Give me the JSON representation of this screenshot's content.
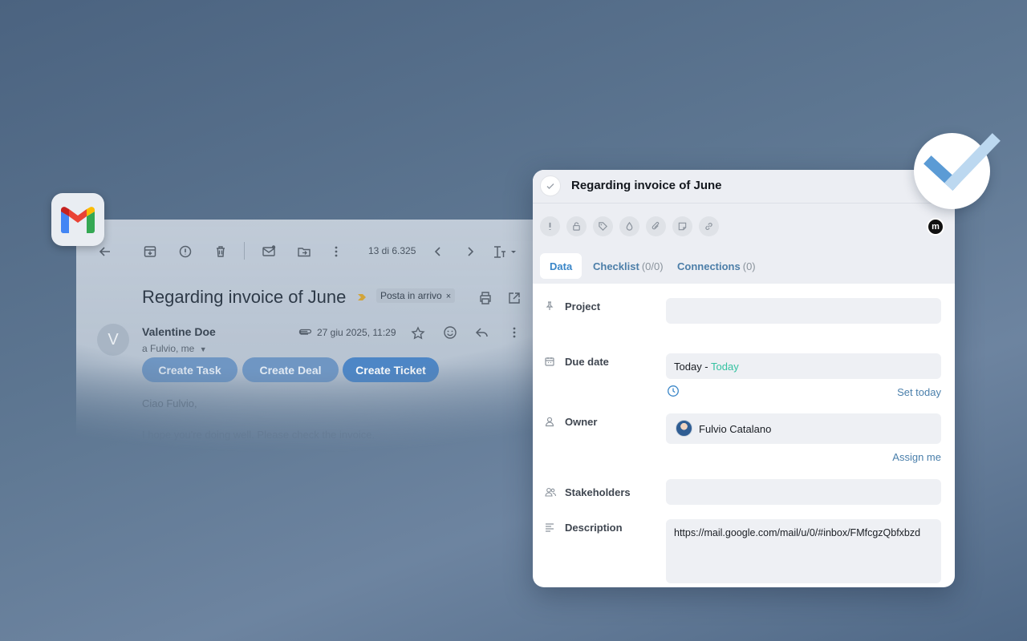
{
  "gmail": {
    "message_count": "13 di 6.325",
    "subject": "Regarding invoice of June",
    "label": "Posta in arrivo",
    "label_close": "×",
    "avatar_letter": "V",
    "sender": "Valentine Doe",
    "recipients": "a Fulvio, me",
    "date": "27 giu 2025, 11:29",
    "buttons": [
      "Create Task",
      "Create Deal",
      "Create Ticket"
    ],
    "body_greeting": "Ciao Fulvio,",
    "body_text": "I hope you're doing well. Please check the invoice."
  },
  "task": {
    "title": "Regarding invoice of June",
    "brand_letter": "m",
    "tabs": [
      {
        "label": "Data",
        "count": ""
      },
      {
        "label": "Checklist",
        "count": "(0/0)"
      },
      {
        "label": "Connections",
        "count": "(0)"
      }
    ],
    "fields": {
      "project_label": "Project",
      "project_value": "",
      "due_label": "Due date",
      "due_value": "Today - ",
      "due_tag": "Today",
      "set_today": "Set today",
      "owner_label": "Owner",
      "owner_value": "Fulvio Catalano",
      "assign_me": "Assign me",
      "stakeholders_label": "Stakeholders",
      "stakeholders_value": "",
      "description_label": "Description",
      "description_value": "https://mail.google.com/mail/u/0/#inbox/FMfcgzQbfxbzd"
    }
  },
  "icons": {
    "gmail_toolbar": [
      "back-arrow-icon",
      "archive-icon",
      "report-spam-icon",
      "delete-icon",
      "mark-unread-icon",
      "move-to-icon",
      "more-vert-icon",
      "prev-icon",
      "next-icon",
      "text-format-icon"
    ],
    "task_toolbar": [
      "priority-icon",
      "lock-icon",
      "tag-icon",
      "color-drop-icon",
      "attachment-icon",
      "note-icon",
      "link-icon"
    ]
  },
  "colors": {
    "accent": "#3a86c8",
    "today": "#35c2a1",
    "gmail_button": "#4d86c6"
  }
}
